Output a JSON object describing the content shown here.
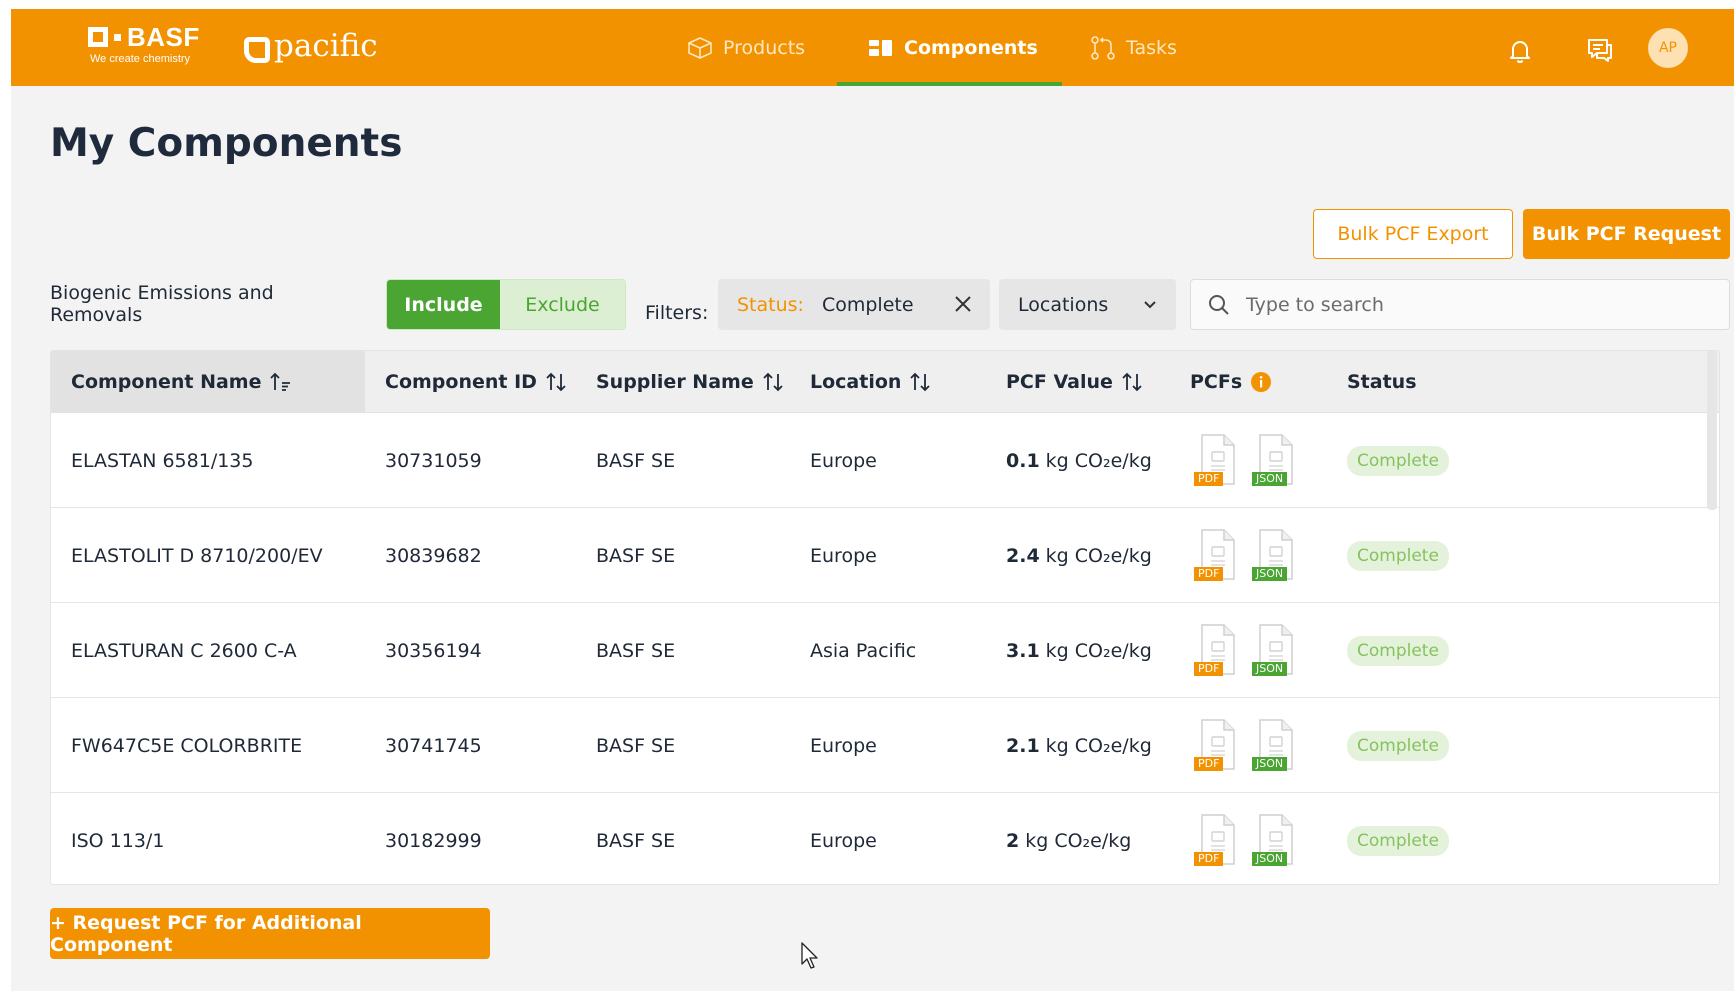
{
  "header": {
    "brand": {
      "name": "BASF",
      "tagline": "We create chemistry"
    },
    "app_logo": "pacific",
    "nav": [
      {
        "label": "Products",
        "icon": "box-icon",
        "active": false
      },
      {
        "label": "Components",
        "icon": "components-icon",
        "active": true
      },
      {
        "label": "Tasks",
        "icon": "tasks-icon",
        "active": false
      }
    ],
    "avatar_initials": "AP"
  },
  "page": {
    "title": "My Components",
    "bulk_export_label": "Bulk PCF Export",
    "bulk_request_label": "Bulk PCF Request"
  },
  "filters": {
    "biogenic_label": "Biogenic Emissions and Removals",
    "include_label": "Include",
    "exclude_label": "Exclude",
    "filters_label": "Filters:",
    "status_key": "Status:",
    "status_value": "Complete",
    "locations_label": "Locations",
    "search_placeholder": "Type to search"
  },
  "table": {
    "columns": {
      "name": "Component Name",
      "id": "Component ID",
      "supplier": "Supplier Name",
      "location": "Location",
      "pcf": "PCF Value",
      "pcfs": "PCFs",
      "status": "Status"
    },
    "rows": [
      {
        "name": "ELASTAN 6581/135",
        "id": "30731059",
        "supplier": "BASF SE",
        "location": "Europe",
        "pcf_value": "0.1",
        "pcf_unit": "kg CO₂e/kg",
        "status": "Complete"
      },
      {
        "name": "ELASTOLIT D 8710/200/EV",
        "id": "30839682",
        "supplier": "BASF SE",
        "location": "Europe",
        "pcf_value": "2.4",
        "pcf_unit": "kg CO₂e/kg",
        "status": "Complete"
      },
      {
        "name": "ELASTURAN C 2600 C-A",
        "id": "30356194",
        "supplier": "BASF SE",
        "location": "Asia Pacific",
        "pcf_value": "3.1",
        "pcf_unit": "kg CO₂e/kg",
        "status": "Complete"
      },
      {
        "name": "FW647C5E COLORBRITE",
        "id": "30741745",
        "supplier": "BASF SE",
        "location": "Europe",
        "pcf_value": "2.1",
        "pcf_unit": "kg CO₂e/kg",
        "status": "Complete"
      },
      {
        "name": "ISO 113/1",
        "id": "30182999",
        "supplier": "BASF SE",
        "location": "Europe",
        "pcf_value": "2",
        "pcf_unit": "kg CO₂e/kg",
        "status": "Complete"
      }
    ],
    "file_labels": {
      "pdf": "PDF",
      "json": "JSON"
    }
  },
  "footer": {
    "request_label": "+ Request PCF for Additional Component"
  },
  "colors": {
    "brand_orange": "#f39200",
    "success_green": "#4aa532",
    "status_badge_bg": "#e4f2dc",
    "status_badge_text": "#86c25f"
  }
}
